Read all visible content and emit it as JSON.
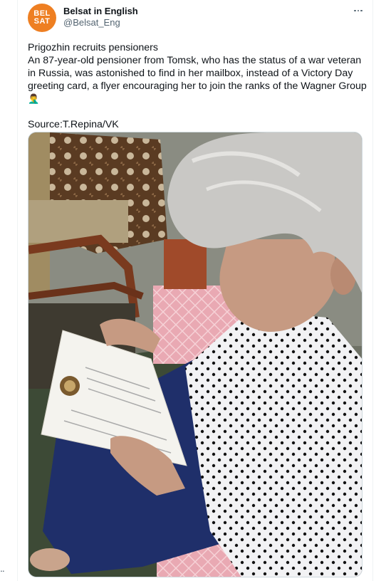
{
  "tweet": {
    "author_name": "Belsat in English",
    "author_handle": "@Belsat_Eng",
    "avatar": {
      "line1": "BEL",
      "line2": "SAT",
      "color": "#ee7f22"
    },
    "headline": "Prigozhin recruits pensioners",
    "body": "An 87-year-old pensioner from Tomsk, who has the status of a war veteran in Russia, was astonished to find in her mailbox, instead of a Victory Day greeting card, a flyer encouraging her to join the ranks of the Wagner Group",
    "emoji": "🤦‍♂️",
    "source": "Source:T.Repina/VK"
  },
  "icons": {
    "more": "more-dots-icon"
  },
  "colors": {
    "text": "#0f1419",
    "secondary": "#536471",
    "border": "#eff3f4",
    "brand": "#ee7f22"
  }
}
